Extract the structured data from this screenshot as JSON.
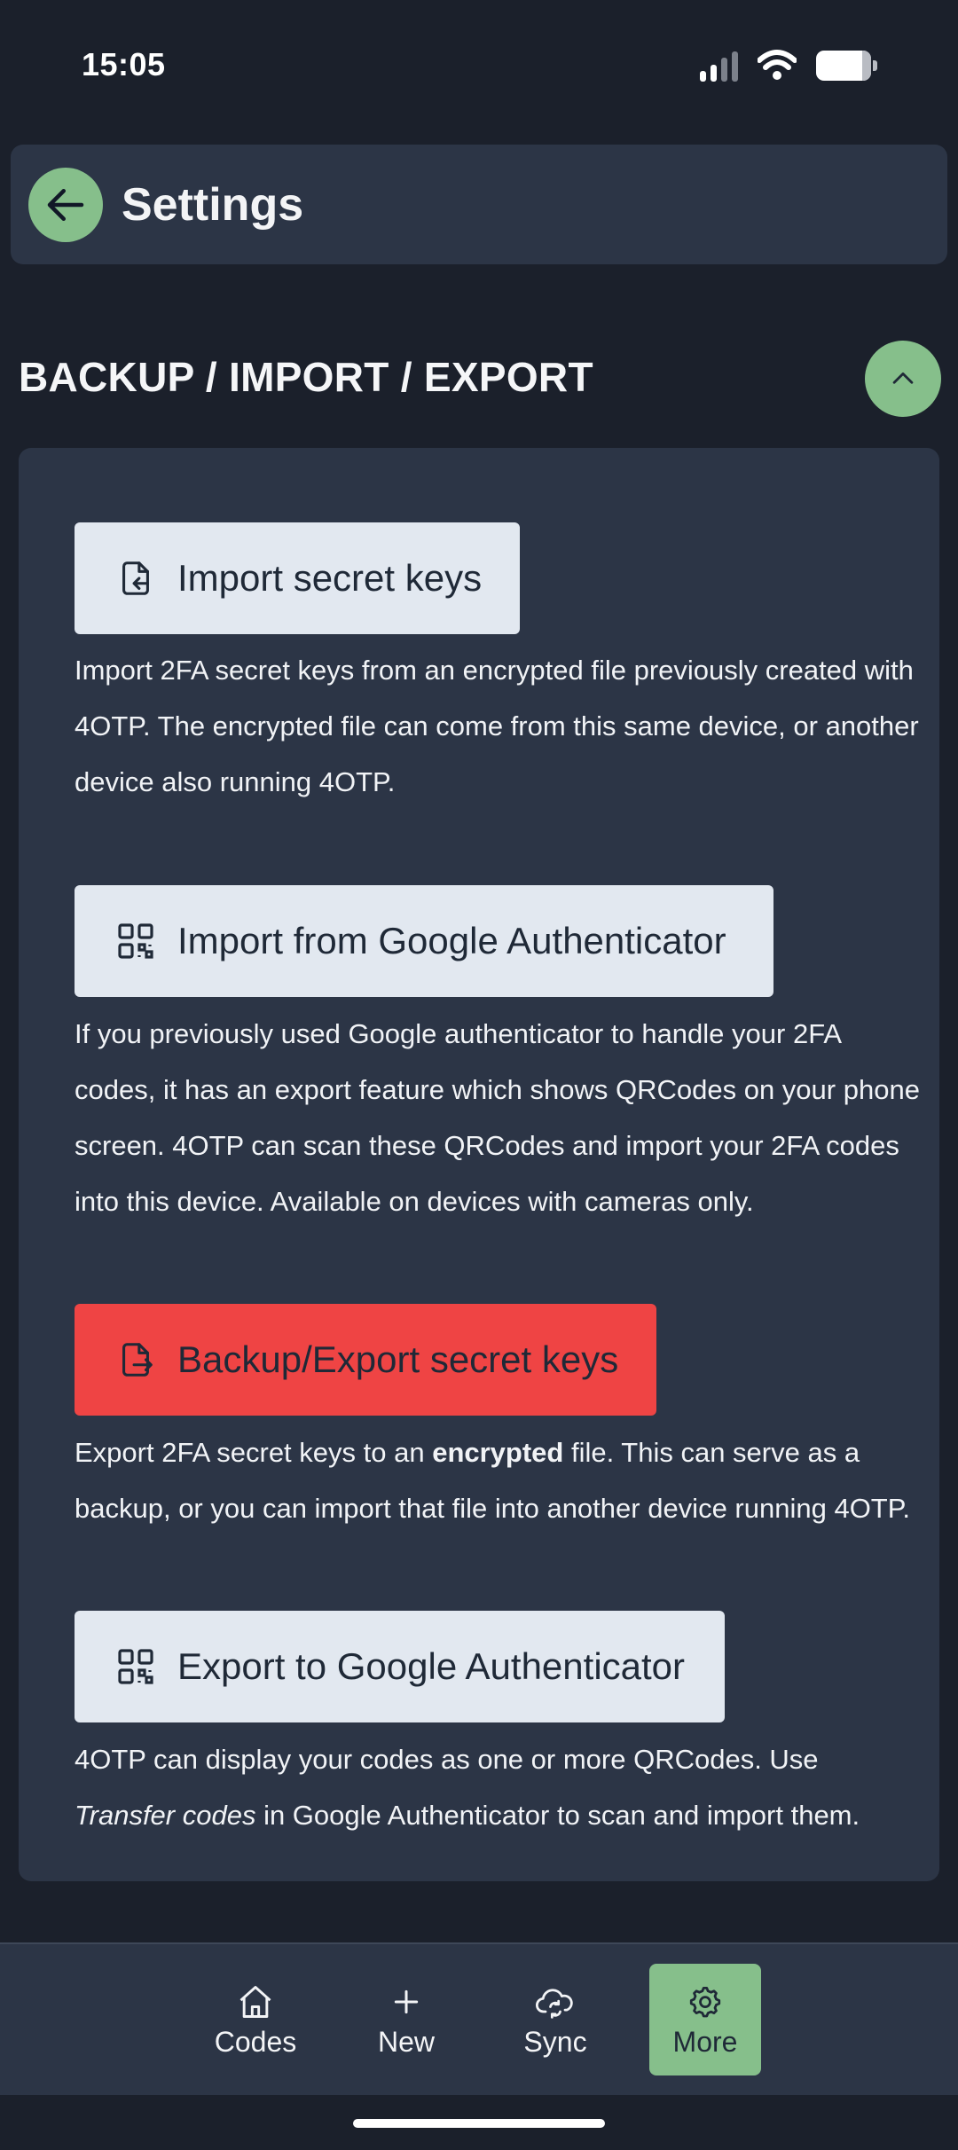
{
  "status": {
    "time": "15:05"
  },
  "header": {
    "title": "Settings",
    "back_icon": "arrow-left-icon"
  },
  "section": {
    "title": "BACKUP / IMPORT / EXPORT",
    "collapse_icon": "chevron-up-icon"
  },
  "actions": {
    "import_keys": {
      "label": "Import secret keys",
      "icon": "file-import-icon",
      "description": "Import 2FA secret keys from an encrypted file previously created with 4OTP. The encrypted file can come from this same device, or another device also running 4OTP."
    },
    "import_google": {
      "label": "Import from Google Authenticator",
      "icon": "qr-code-icon",
      "description": "If you previously used Google authenticator to handle your 2FA codes, it has an export feature which shows QRCodes on your phone screen. 4OTP can scan these QRCodes and import your 2FA codes into this device. Available on devices with cameras only."
    },
    "export_keys": {
      "label": "Backup/Export secret keys",
      "icon": "file-export-icon",
      "description_start": "Export 2FA secret keys to an ",
      "description_bold": "encrypted",
      "description_end": " file. This can serve as a backup, or you can import that file into another device running 4OTP."
    },
    "export_google": {
      "label": "Export to Google Authenticator",
      "icon": "qr-code-icon",
      "description_start": "4OTP can display your codes as one or more QRCodes. Use ",
      "description_italic": "Transfer codes",
      "description_end": " in Google Authenticator to scan and import them."
    }
  },
  "nav": {
    "items": [
      {
        "label": "Codes",
        "icon": "home-icon"
      },
      {
        "label": "New",
        "icon": "plus-icon"
      },
      {
        "label": "Sync",
        "icon": "cloud-sync-icon"
      },
      {
        "label": "More",
        "icon": "gear-icon"
      }
    ],
    "active": "More"
  },
  "colors": {
    "background": "#1b202b",
    "surface": "#2c3546",
    "accent": "#86bf8b",
    "danger": "#ef4444",
    "button_light": "#e2e8f0"
  }
}
